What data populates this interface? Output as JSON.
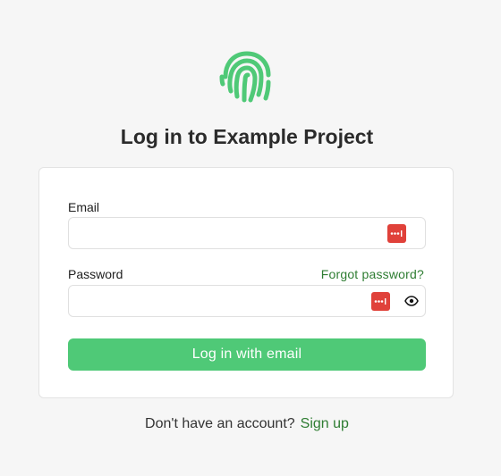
{
  "app": {
    "title": "Log in to Example Project",
    "logo_icon": "fingerprint-icon",
    "accent_color": "#4fc977"
  },
  "form": {
    "email_label": "Email",
    "email_value": "",
    "password_label": "Password",
    "password_value": "",
    "forgot_password_label": "Forgot password?",
    "submit_label": "Log in with email",
    "password_manager_icon": "password-manager-icon",
    "show_password_icon": "eye-icon"
  },
  "footer": {
    "prompt": "Don't have an account?",
    "signup_label": "Sign up"
  }
}
